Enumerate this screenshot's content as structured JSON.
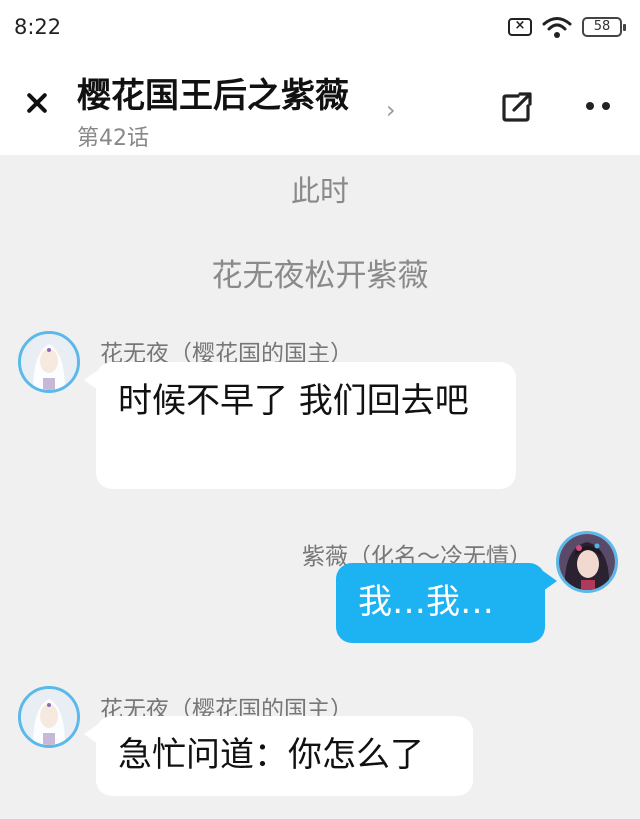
{
  "status_bar": {
    "time": "8:22",
    "battery": "58"
  },
  "header": {
    "title": "樱花国王后之紫薇",
    "chapter": "第42话"
  },
  "narration": [
    "此时",
    "花无夜松开紫薇"
  ],
  "messages": [
    {
      "speaker": "花无夜（樱花国的国主）",
      "text": "时候不早了 我们回去吧",
      "side": "left"
    },
    {
      "speaker": "紫薇（化名～冷无情）",
      "text": "我…我…",
      "side": "right"
    },
    {
      "speaker": "花无夜（樱花国的国主）",
      "text": "急忙问道：你怎么了",
      "side": "left"
    }
  ],
  "colors": {
    "accent": "#1db2f2",
    "avatar_ring": "#5ab8ea",
    "background": "#f0f0f0"
  }
}
